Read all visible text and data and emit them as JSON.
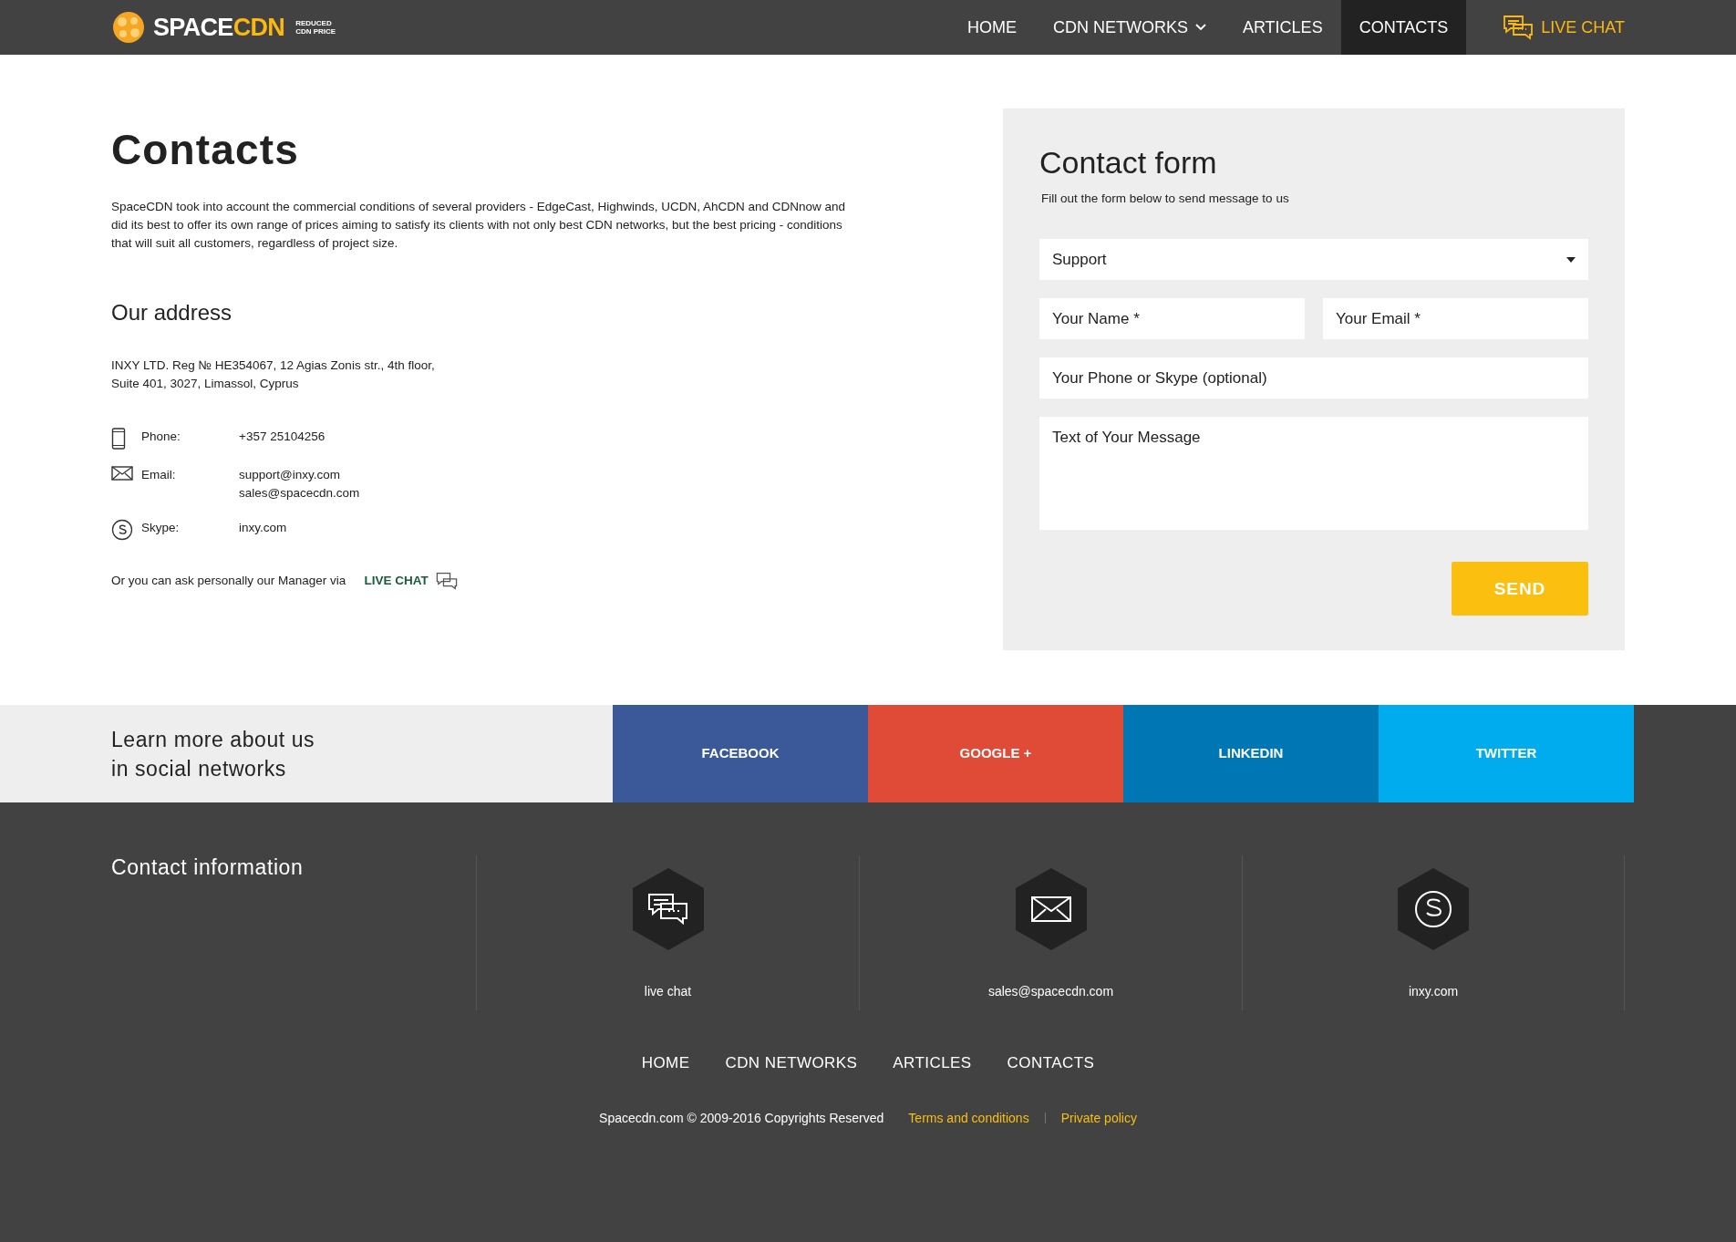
{
  "header": {
    "logo": {
      "word_1": "SPACE",
      "word_2": "CDN",
      "tagline": [
        "REDUCED",
        "CDN PRICE"
      ]
    },
    "nav": [
      {
        "label": "HOME",
        "selected": false,
        "kind": "link"
      },
      {
        "label": "CDN NETWORKS",
        "selected": false,
        "kind": "dropdown"
      },
      {
        "label": "ARTICLES",
        "selected": false,
        "kind": "link"
      },
      {
        "label": "CONTACTS",
        "selected": true,
        "kind": "link"
      }
    ],
    "live_chat": "LIVE CHAT"
  },
  "contacts": {
    "title": "Contacts",
    "intro": "SpaceCDN took into account the commercial conditions of several providers - EdgeCast, Highwinds, UCDN, AhCDN and CDNnow and did its best to offer its own range of prices aiming to satisfy its clients with not only best CDN networks, but the best pricing - conditions that will suit all customers, regardless of project size.",
    "address_heading": "Our address",
    "address": [
      "INXY LTD. Reg № HE354067, 12 Agias Zonis str., 4th floor,",
      "Suite 401, 3027, Limassol, Cyprus"
    ],
    "rows": [
      {
        "kind": "phone",
        "label": "Phone:",
        "values": [
          "+357 25104256"
        ]
      },
      {
        "kind": "email",
        "label": "Email:",
        "values": [
          "support@inxy.com",
          "sales@spacecdn.com"
        ]
      },
      {
        "kind": "skype",
        "label": "Skype:",
        "values": [
          "inxy.com"
        ]
      }
    ],
    "manager_note": "Or you can ask personally our Manager via",
    "live_chat_link": "LIVE CHAT"
  },
  "contact_form": {
    "title": "Contact form",
    "subtitle": "Fill out the form below to send message to us",
    "topic": "Support",
    "name_placeholder": "Your Name *",
    "email_placeholder": "Your Email *",
    "phone_placeholder": "Your Phone or Skype (optional)",
    "message_placeholder": "Text of Your Message",
    "send": "SEND"
  },
  "social": {
    "heading": [
      "Learn more about us",
      "in social networks"
    ],
    "networks": [
      {
        "label": "FACEBOOK",
        "color": "#3b5998"
      },
      {
        "label": "GOOGLE +",
        "color": "#e04b38"
      },
      {
        "label": "LINKEDIN",
        "color": "#0077b5"
      },
      {
        "label": "TWITTER",
        "color": "#00acee"
      }
    ]
  },
  "footer": {
    "contact_heading": "Contact information",
    "channels": [
      {
        "kind": "chat",
        "label": "live chat"
      },
      {
        "kind": "email",
        "label": "sales@spacecdn.com"
      },
      {
        "kind": "skype",
        "label": "inxy.com"
      }
    ],
    "nav": [
      "HOME",
      "CDN NETWORKS",
      "ARTICLES",
      "CONTACTS"
    ],
    "copyright": "Spacecdn.com © 2009-2016 Copyrights Reserved",
    "links": [
      "Terms and conditions",
      "Private policy"
    ]
  }
}
